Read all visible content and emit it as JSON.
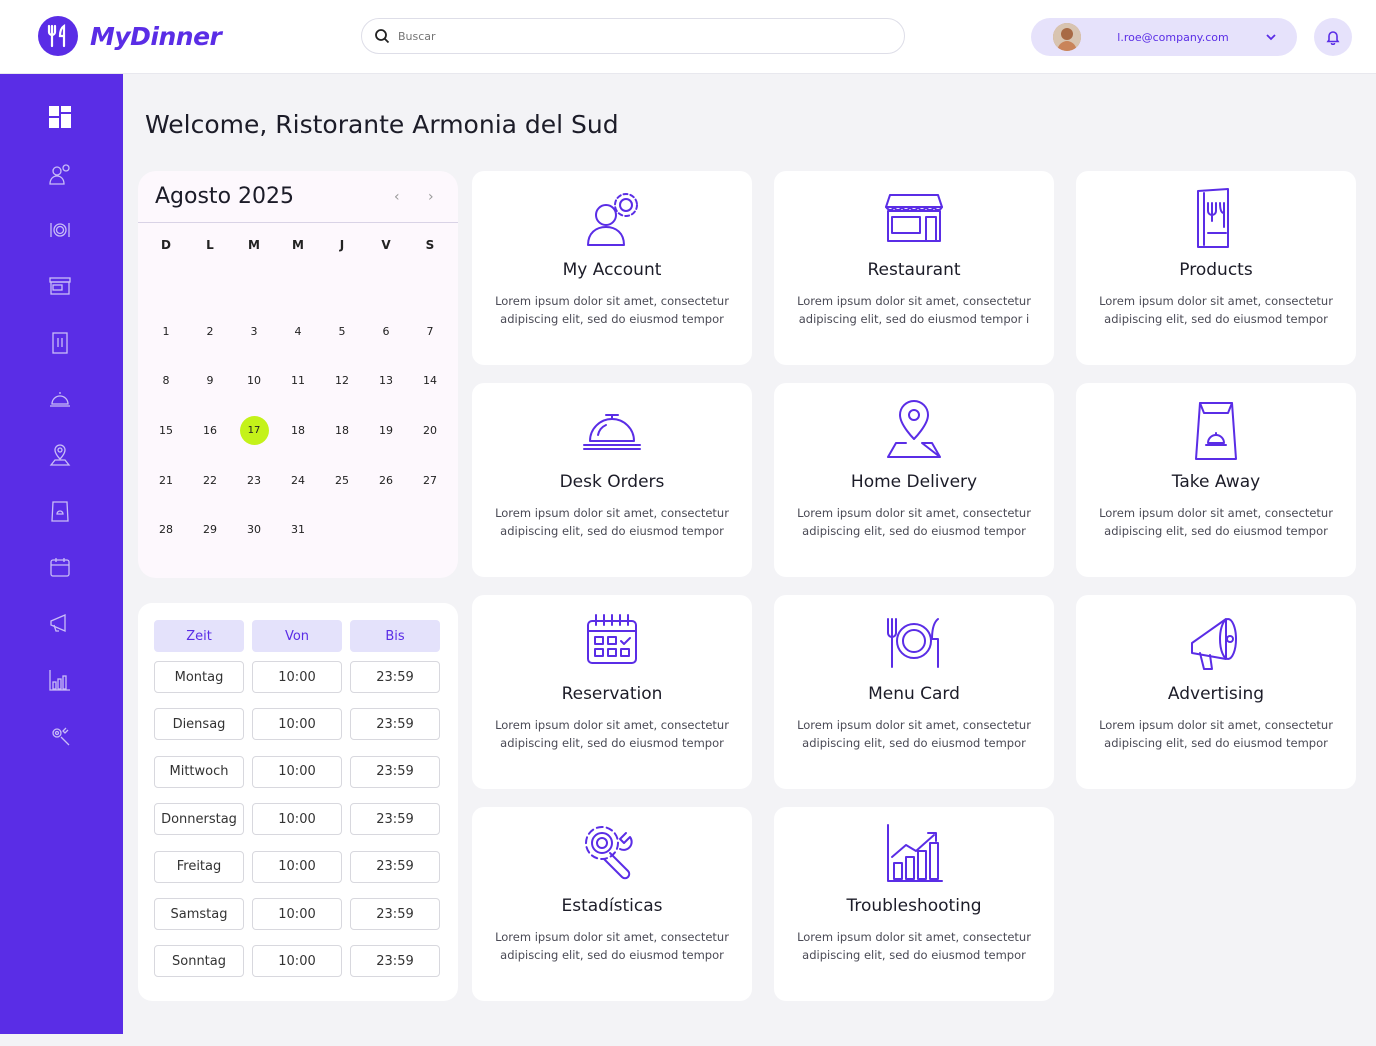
{
  "brand": {
    "name": "MyDinner"
  },
  "search": {
    "placeholder": "Buscar"
  },
  "user": {
    "email": "l.roe@company.com"
  },
  "welcome": "Welcome, Ristorante Armonia del Sud",
  "calendar": {
    "title": "Agosto 2025",
    "prev": "‹",
    "next": "›",
    "weekdays": [
      "D",
      "L",
      "M",
      "M",
      "J",
      "V",
      "S"
    ],
    "weeks": [
      [
        "",
        "",
        "",
        "",
        "",
        "",
        ""
      ],
      [
        "1",
        "2",
        "3",
        "4",
        "5",
        "6",
        "7"
      ],
      [
        "8",
        "9",
        "10",
        "11",
        "12",
        "13",
        "14"
      ],
      [
        "15",
        "16",
        "17",
        "18",
        "18",
        "19",
        "20"
      ],
      [
        "21",
        "22",
        "23",
        "24",
        "25",
        "26",
        "27"
      ],
      [
        "28",
        "29",
        "30",
        "31",
        "",
        "",
        ""
      ]
    ],
    "today": "17"
  },
  "hours": {
    "headers": [
      "Zeit",
      "Von",
      "Bis"
    ],
    "rows": [
      [
        "Montag",
        "10:00",
        "23:59"
      ],
      [
        "Diensag",
        "10:00",
        "23:59"
      ],
      [
        "Mittwoch",
        "10:00",
        "23:59"
      ],
      [
        "Donnerstag",
        "10:00",
        "23:59"
      ],
      [
        "Freitag",
        "10:00",
        "23:59"
      ],
      [
        "Samstag",
        "10:00",
        "23:59"
      ],
      [
        "Sonntag",
        "10:00",
        "23:59"
      ]
    ]
  },
  "cards": [
    {
      "title": "My Account",
      "desc": "Lorem ipsum dolor sit amet, consectetur adipiscing elit, sed do eiusmod  tempor",
      "icon": "account-settings-icon"
    },
    {
      "title": "Restaurant",
      "desc": "Lorem ipsum dolor sit amet, consectetur adipiscing elit, sed do eiusmod  tempor i",
      "icon": "storefront-icon"
    },
    {
      "title": "Products",
      "desc": "Lorem ipsum dolor sit amet, consectetur adipiscing elit, sed do eiusmod  tempor",
      "icon": "menu-book-icon"
    },
    {
      "title": "Desk Orders",
      "desc": "Lorem ipsum dolor sit amet, consectetur adipiscing elit, sed do eiusmod  tempor",
      "icon": "service-bell-icon"
    },
    {
      "title": "Home Delivery",
      "desc": "Lorem ipsum dolor sit amet, consectetur adipiscing elit, sed do eiusmod  tempor",
      "icon": "map-pin-icon"
    },
    {
      "title": "Take Away",
      "desc": "Lorem ipsum dolor sit amet, consectetur adipiscing elit, sed do eiusmod  tempor",
      "icon": "takeaway-bag-icon"
    },
    {
      "title": "Reservation",
      "desc": "Lorem ipsum dolor sit amet, consectetur adipiscing elit, sed do eiusmod  tempor",
      "icon": "calendar-icon"
    },
    {
      "title": "Menu Card",
      "desc": "Lorem ipsum dolor sit amet, consectetur adipiscing elit, sed do eiusmod  tempor",
      "icon": "plate-cutlery-icon"
    },
    {
      "title": "Advertising",
      "desc": "Lorem ipsum dolor sit amet, consectetur adipiscing elit, sed do eiusmod  tempor",
      "icon": "megaphone-icon"
    },
    {
      "title": "Estadísticas",
      "desc": "Lorem ipsum dolor sit amet, consectetur adipiscing elit, sed do eiusmod  tempor",
      "icon": "gear-wrench-icon"
    },
    {
      "title": "Troubleshooting",
      "desc": "Lorem ipsum dolor sit amet, consectetur adipiscing elit, sed do eiusmod  tempor",
      "icon": "bar-chart-icon"
    }
  ],
  "sidebar": [
    "dashboard-icon",
    "account-settings-icon",
    "plate-cutlery-icon",
    "storefront-icon",
    "menu-book-icon",
    "service-bell-icon",
    "map-pin-icon",
    "takeaway-bag-icon",
    "calendar-icon",
    "megaphone-icon",
    "bar-chart-icon",
    "gear-wrench-icon"
  ],
  "colors": {
    "accent": "#5a2de6",
    "highlight": "#c4f21a",
    "background": "#f3f3f6"
  }
}
